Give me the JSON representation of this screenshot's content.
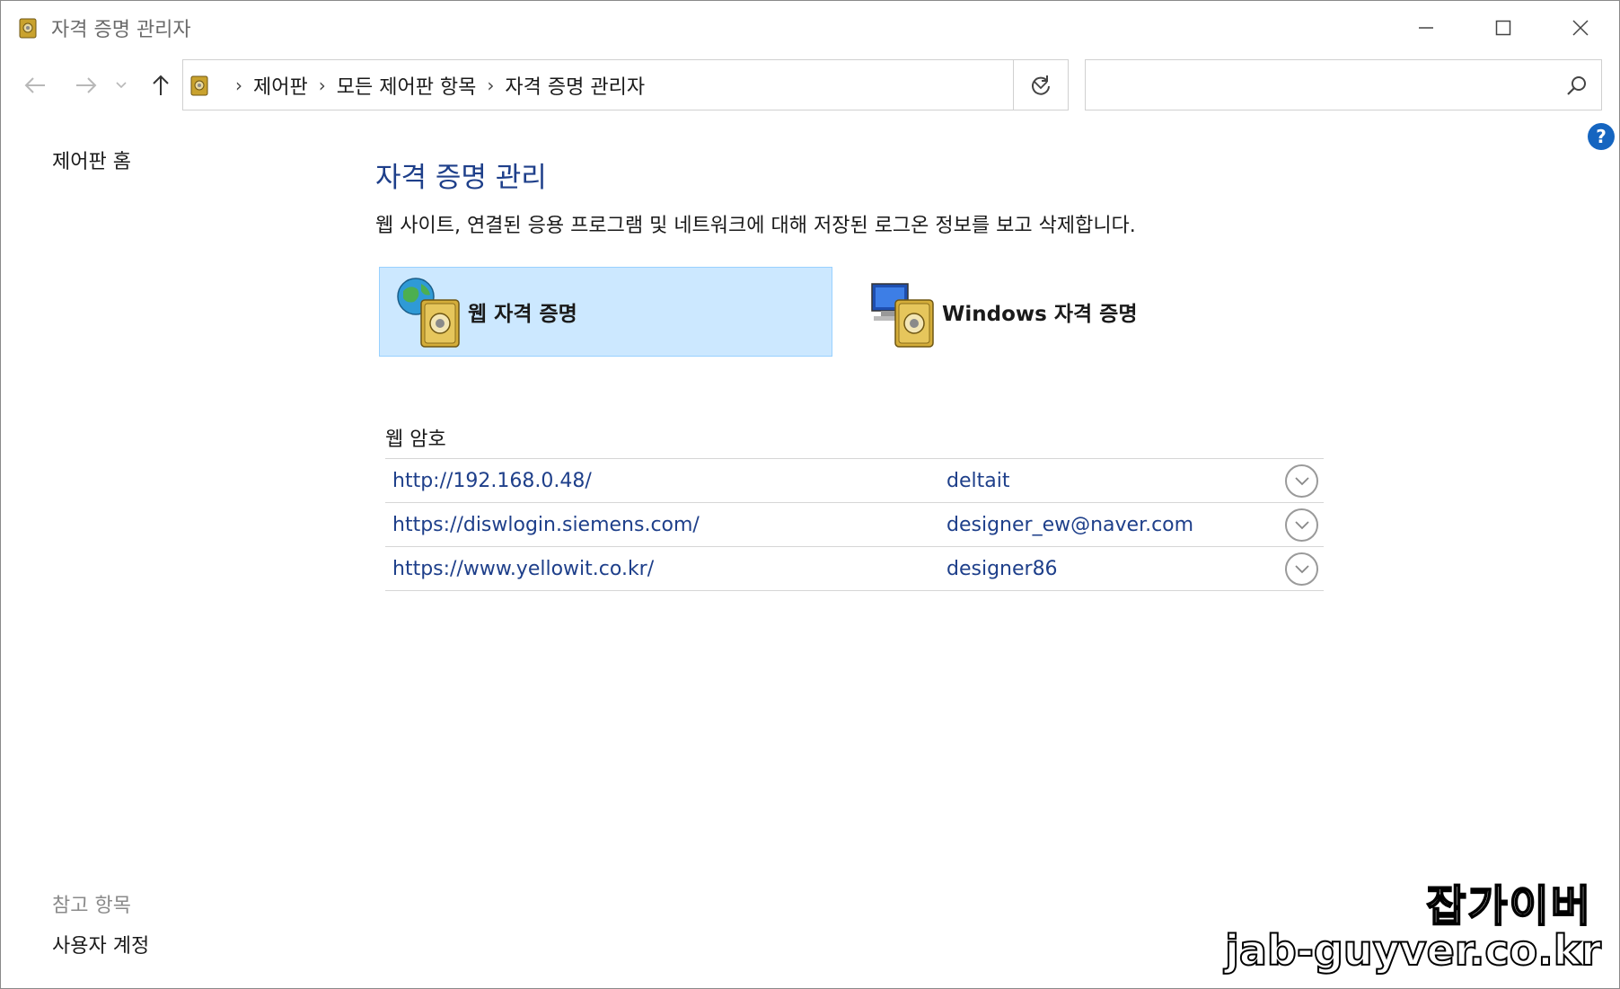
{
  "window": {
    "title": "자격 증명 관리자"
  },
  "navbar": {
    "breadcrumbs": [
      "제어판",
      "모든 제어판 항목",
      "자격 증명 관리자"
    ],
    "search_value": "",
    "search_placeholder": ""
  },
  "sidebar": {
    "home_link": "제어판 홈",
    "see_also_heading": "참고 항목",
    "user_accounts_link": "사용자 계정"
  },
  "main": {
    "title": "자격 증명 관리",
    "description": "웹 사이트, 연결된 응용 프로그램 및 네트워크에 대해 저장된 로그온 정보를 보고 삭제합니다.",
    "tiles": [
      {
        "label": "웹 자격 증명",
        "icon": "globe-vault-icon",
        "selected": true
      },
      {
        "label": "Windows 자격 증명",
        "icon": "computer-vault-icon",
        "selected": false
      }
    ],
    "section_label": "웹 암호",
    "passwords": [
      {
        "url": "http://192.168.0.48/",
        "user": "deltait"
      },
      {
        "url": "https://diswlogin.siemens.com/",
        "user": "designer_ew@naver.com"
      },
      {
        "url": "https://www.yellowit.co.kr/",
        "user": "designer86"
      }
    ]
  },
  "watermark": {
    "line1": "잡가이버",
    "line2": "jab-guyver.co.kr"
  },
  "colors": {
    "title_blue": "#1e3f8a",
    "selected_tile_bg": "#cce8ff",
    "help_blue": "#1565c0"
  }
}
